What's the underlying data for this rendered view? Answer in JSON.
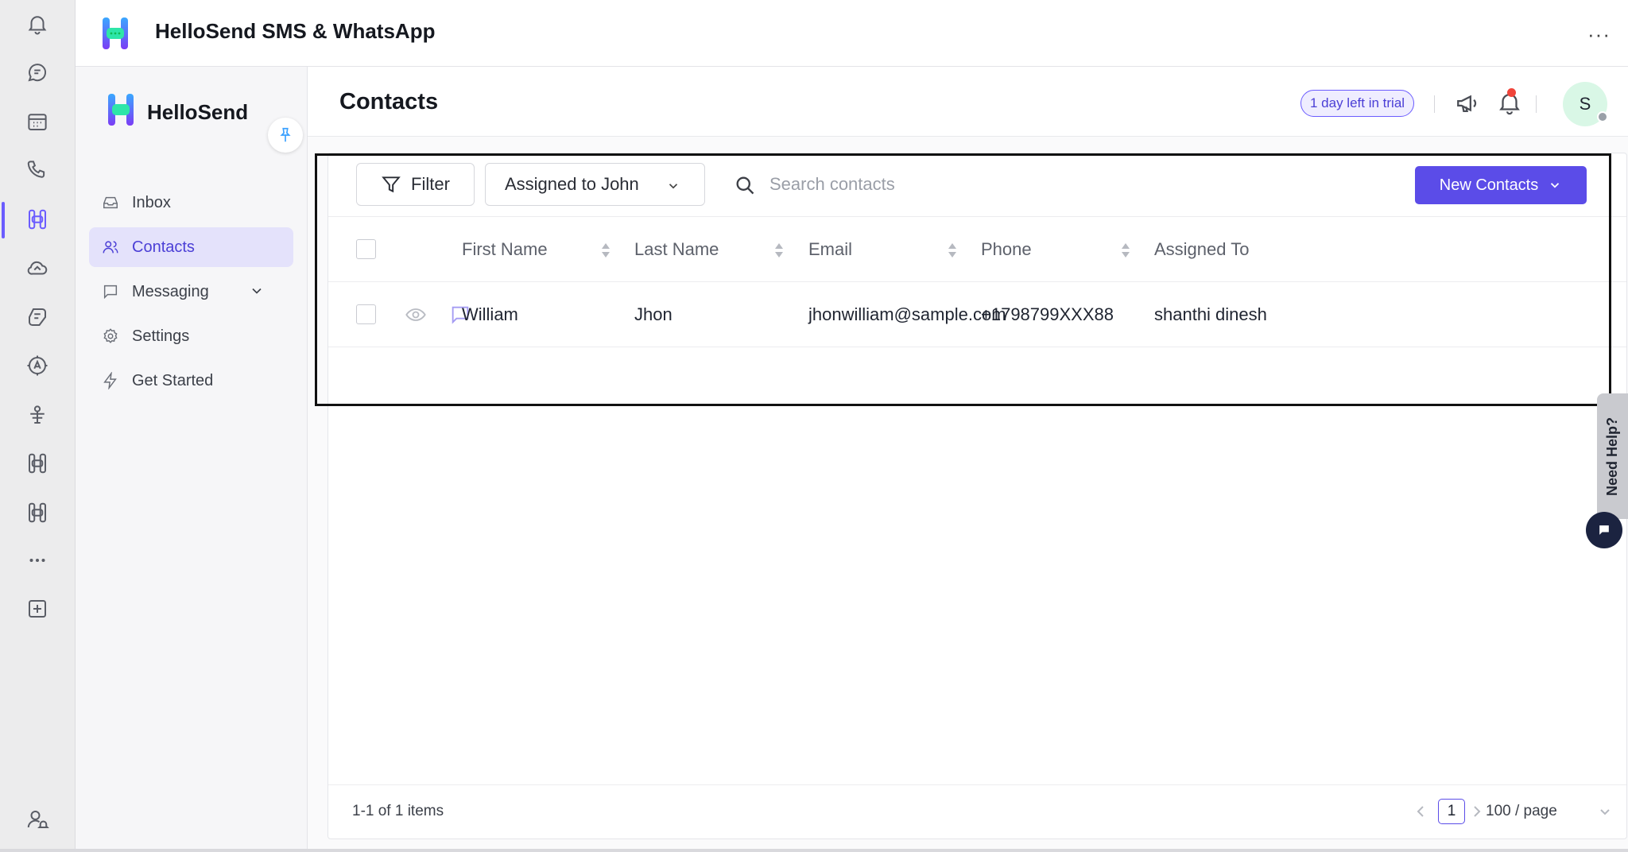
{
  "app": {
    "title": "HelloSend SMS & WhatsApp",
    "more_glyph": "···",
    "brand_name": "HelloSend",
    "brand_colors": {
      "primary": "#5b4ce8",
      "logo_gradient": [
        "#3aa8ff",
        "#7b3cf5"
      ],
      "logo_center": "#2ee6a8"
    }
  },
  "rail": {
    "icons": [
      "bell-icon",
      "message-circle-icon",
      "calendar-icon",
      "phone-icon",
      "hellosend-app-icon",
      "cloud-icon",
      "copilot-icon",
      "translate-app-icon",
      "agent-icon",
      "app-icon-2",
      "app-icon-3",
      "more-icon",
      "add-app-icon",
      "user-notification-icon"
    ]
  },
  "nav": {
    "items": [
      {
        "label": "Inbox",
        "icon": "inbox-icon",
        "active": false
      },
      {
        "label": "Contacts",
        "icon": "users-icon",
        "active": true
      },
      {
        "label": "Messaging",
        "icon": "message-square-icon",
        "active": false,
        "expandable": true
      },
      {
        "label": "Settings",
        "icon": "gear-icon",
        "active": false
      },
      {
        "label": "Get Started",
        "icon": "bolt-icon",
        "active": false
      }
    ]
  },
  "header": {
    "page_title": "Contacts",
    "trial_badge": "1 day left in trial",
    "avatar_initial": "S"
  },
  "toolbar": {
    "filter_label": "Filter",
    "assign_filter_value": "Assigned to John",
    "search_placeholder": "Search contacts",
    "search_value": "",
    "new_contacts_label": "New Contacts"
  },
  "table": {
    "columns": [
      "First Name",
      "Last Name",
      "Email",
      "Phone",
      "Assigned To"
    ],
    "rows": [
      {
        "first_name": "William",
        "last_name": "Jhon",
        "email": "jhonwilliam@sample.com",
        "phone": "+1798799XXX88",
        "assigned_to": "shanthi dinesh"
      }
    ]
  },
  "footer": {
    "count_text": "1-1 of 1 items",
    "current_page": "1",
    "page_size": "100 / page"
  },
  "help": {
    "label": "Need Help?"
  }
}
